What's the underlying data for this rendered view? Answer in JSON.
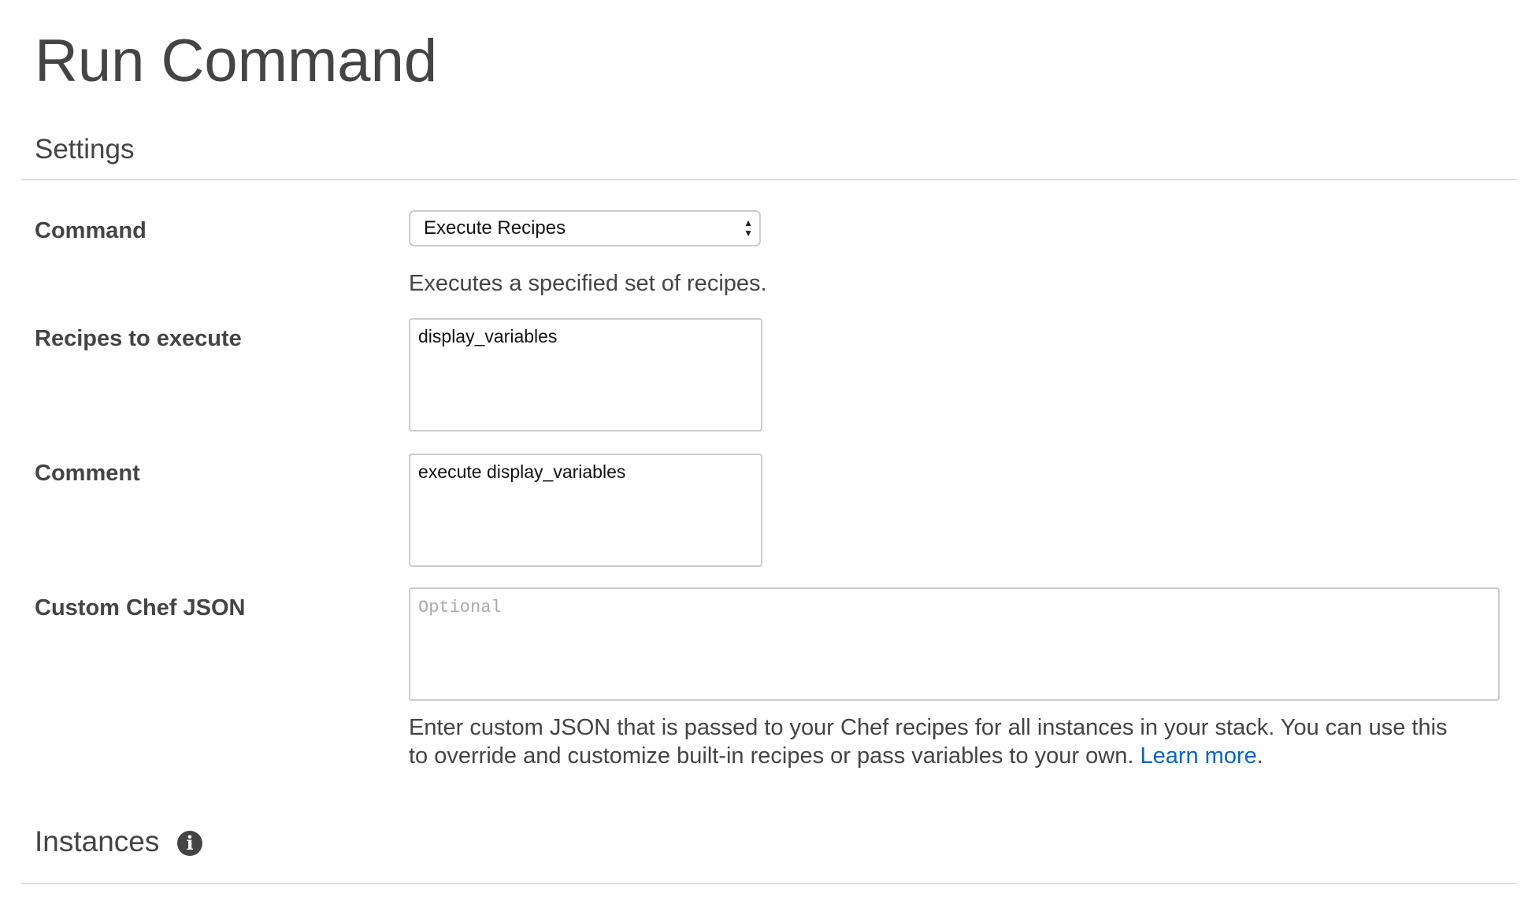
{
  "page_title": "Run Command",
  "settings": {
    "heading": "Settings",
    "command": {
      "label": "Command",
      "selected": "Execute Recipes",
      "description": "Executes a specified set of recipes."
    },
    "recipes": {
      "label": "Recipes to execute",
      "value": "display_variables"
    },
    "comment": {
      "label": "Comment",
      "value": "execute display_variables"
    },
    "custom_json": {
      "label": "Custom Chef JSON",
      "placeholder": "Optional",
      "help_line1": "Enter custom JSON that is passed to your Chef recipes for all instances in your stack. You can use this",
      "help_line2": "to override and customize built-in recipes or pass variables to your own. ",
      "learn_more": "Learn more",
      "period": "."
    }
  },
  "instances": {
    "heading": "Instances",
    "info_icon": "info-icon"
  },
  "colors": {
    "text": "#444444",
    "link": "#0a64c2",
    "border": "#cccccc"
  }
}
